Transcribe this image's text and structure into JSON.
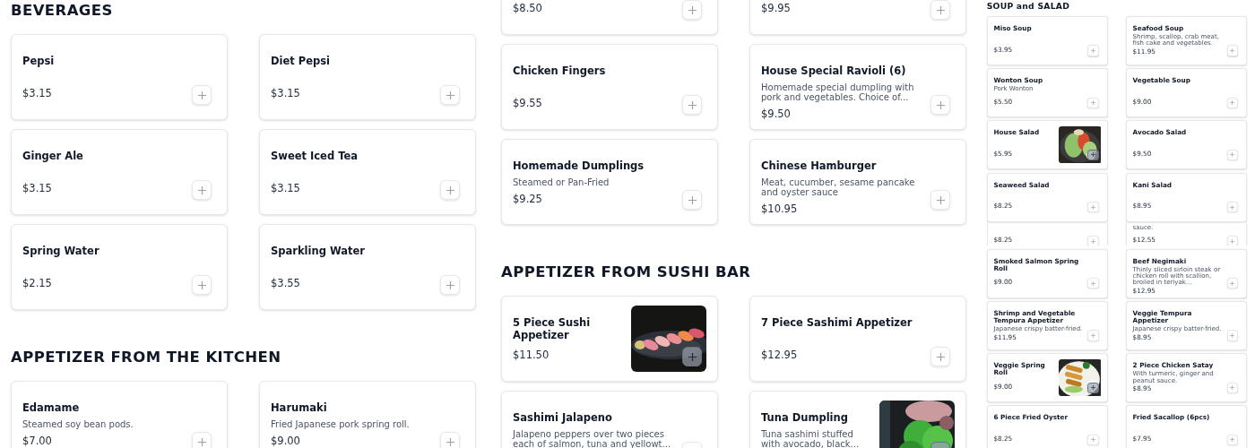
{
  "panels": [
    {
      "blocks": [
        {
          "kind": "heading",
          "text": "BEVERAGES"
        },
        {
          "kind": "grid",
          "items": [
            {
              "kind": "plain",
              "name": "Pepsi",
              "price": "$3.15"
            },
            {
              "kind": "plain",
              "name": "Diet Pepsi",
              "price": "$3.15"
            },
            {
              "kind": "plain",
              "name": "Ginger Ale",
              "price": "$3.15"
            },
            {
              "kind": "plain",
              "name": "Sweet Iced Tea",
              "price": "$3.15"
            },
            {
              "kind": "plain",
              "name": "Spring Water",
              "price": "$2.15"
            },
            {
              "kind": "plain",
              "name": "Sparkling Water",
              "price": "$3.55"
            }
          ]
        },
        {
          "kind": "heading",
          "text": "APPETIZER FROM THE KITCHEN"
        },
        {
          "kind": "grid",
          "items": [
            {
              "kind": "plain",
              "name": "Edamame",
              "description": "Steamed soy bean pods.",
              "price": "$7.00"
            },
            {
              "kind": "plain",
              "name": "Harumaki",
              "description": "Fried Japanese pork spring roll.",
              "price": "$9.00"
            }
          ]
        }
      ]
    },
    {
      "blocks": [
        {
          "kind": "grid",
          "items": [
            {
              "kind": "plain",
              "price": "$8.50"
            },
            {
              "kind": "plain",
              "price": "$9.95"
            },
            {
              "kind": "plain",
              "name": "Chicken Fingers",
              "price": "$9.55"
            },
            {
              "kind": "plain",
              "name": "House Special Ravioli (6)",
              "description": "Homemade special dumpling with pork and vegetables. Choice of...",
              "price": "$9.50"
            },
            {
              "kind": "plain",
              "name": "Homemade Dumplings",
              "description": "Steamed or Pan-Fried",
              "price": "$9.25"
            },
            {
              "kind": "plain",
              "name": "Chinese Hamburger",
              "description": "Meat, cucumber, sesame pancake and oyster sauce",
              "price": "$10.95"
            }
          ]
        },
        {
          "kind": "heading",
          "text": "APPETIZER FROM SUSHI BAR"
        },
        {
          "kind": "grid",
          "items": [
            {
              "kind": "picture",
              "name": "5 Piece Sushi Appetizer",
              "price": "$11.50"
            },
            {
              "kind": "plain",
              "name": "7 Piece Sashimi Appetizer",
              "price": "$12.95"
            },
            {
              "kind": "plain",
              "name": "Sashimi Jalapeno",
              "description": "Jalapeno peppers over two pieces each of salmon, tuna and yellowt..."
            },
            {
              "kind": "picture",
              "name": "Tuna Dumpling",
              "description": "Tuna sashimi stuffed with avocado, black..."
            }
          ]
        }
      ]
    },
    {
      "blocks": [
        {
          "kind": "heading",
          "text": "SOUP and SALAD"
        },
        {
          "kind": "grid",
          "items": [
            {
              "kind": "plain",
              "name": "Miso Soup",
              "price": "$3.95"
            },
            {
              "kind": "plain",
              "name": "Seafood Soup",
              "description": "Shrimp, scallop, crab meat, fish cake and vegetables.",
              "price": "$11.95"
            },
            {
              "kind": "plain",
              "name": "Wonton Soup",
              "description": "Pork Wonton",
              "price": "$5.50"
            },
            {
              "kind": "plain",
              "name": "Vegetable Soup",
              "price": "$9.00"
            },
            {
              "kind": "picture",
              "name": "House Salad",
              "price": "$5.95"
            },
            {
              "kind": "plain",
              "name": "Avocado Salad",
              "price": "$9.50"
            },
            {
              "kind": "plain",
              "name": "Seaweed Salad",
              "price": "$8.25"
            },
            {
              "kind": "plain",
              "name": "Kani Salad",
              "price": "$8.95"
            }
          ]
        },
        {
          "kind": "partial",
          "items": [
            {
              "kind": "plain",
              "price": "$8.25"
            },
            {
              "kind": "plain",
              "description": "sauce.",
              "price": "$12.55"
            }
          ]
        },
        {
          "kind": "grid",
          "items": [
            {
              "kind": "plain",
              "name": "Smoked Salmon Spring Roll",
              "price": "$9.00"
            },
            {
              "kind": "plain",
              "name": "Beef Negimaki",
              "description": "Thinly sliced sirloin steak or chicken roll with scallion, broiled in teriyak...",
              "price": "$12.95"
            },
            {
              "kind": "plain",
              "name": "Shrimp and Vegetable Tempura Appetizer",
              "description": "Japanese crispy batter-fried.",
              "price": "$11.95"
            },
            {
              "kind": "plain",
              "name": "Veggie Tempura Appetizer",
              "description": "Japanese crispy batter-fried.",
              "price": "$8.95"
            },
            {
              "kind": "picture",
              "name": "Veggie Spring Roll",
              "price": "$9.00"
            },
            {
              "kind": "plain",
              "name": "2 Piece Chicken Satay",
              "description": "With turmeric, ginger and peanut sauce.",
              "price": "$8.95"
            },
            {
              "kind": "plain",
              "name": "6 Piece Fried Oyster",
              "price": "$8.25"
            },
            {
              "kind": "plain",
              "name": "Fried Sacallop (6pcs)",
              "price": "$7.95"
            }
          ]
        }
      ]
    }
  ]
}
